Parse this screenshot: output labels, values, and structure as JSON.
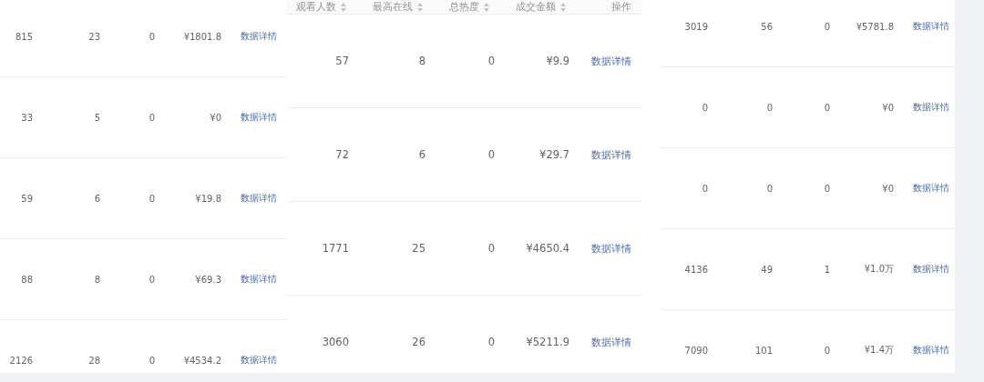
{
  "panels": [
    {
      "rows": [
        {
          "cells": [
            "815",
            "23",
            "0",
            "¥1801.8"
          ],
          "action": "数据详情"
        },
        {
          "cells": [
            "33",
            "5",
            "0",
            "¥0"
          ],
          "action": "数据详情"
        },
        {
          "cells": [
            "59",
            "6",
            "0",
            "¥19.8"
          ],
          "action": "数据详情"
        },
        {
          "cells": [
            "88",
            "8",
            "0",
            "¥69.3"
          ],
          "action": "数据详情"
        },
        {
          "cells": [
            "2126",
            "28",
            "0",
            "¥4534.2"
          ],
          "action": "数据详情"
        }
      ]
    },
    {
      "columns": [
        {
          "label": "观看人数",
          "sortable": true
        },
        {
          "label": "最高在线",
          "sortable": true
        },
        {
          "label": "总热度",
          "sortable": true
        },
        {
          "label": "成交金额",
          "sortable": true
        },
        {
          "label": "操作",
          "sortable": false
        }
      ],
      "rows": [
        {
          "cells": [
            "57",
            "8",
            "0",
            "¥9.9"
          ],
          "action": "数据详情"
        },
        {
          "cells": [
            "72",
            "6",
            "0",
            "¥29.7"
          ],
          "action": "数据详情"
        },
        {
          "cells": [
            "1771",
            "25",
            "0",
            "¥4650.4"
          ],
          "action": "数据详情"
        },
        {
          "cells": [
            "3060",
            "26",
            "0",
            "¥5211.9"
          ],
          "action": "数据详情"
        }
      ]
    },
    {
      "rows": [
        {
          "cells": [
            "3019",
            "56",
            "0",
            "¥5781.8"
          ],
          "action": "数据详情"
        },
        {
          "cells": [
            "0",
            "0",
            "0",
            "¥0"
          ],
          "action": "数据详情"
        },
        {
          "cells": [
            "0",
            "0",
            "0",
            "¥0"
          ],
          "action": "数据详情"
        },
        {
          "cells": [
            "4136",
            "49",
            "1",
            "¥1.0万"
          ],
          "action": "数据详情"
        },
        {
          "cells": [
            "7090",
            "101",
            "0",
            "¥1.4万"
          ],
          "action": "数据详情"
        }
      ]
    }
  ]
}
